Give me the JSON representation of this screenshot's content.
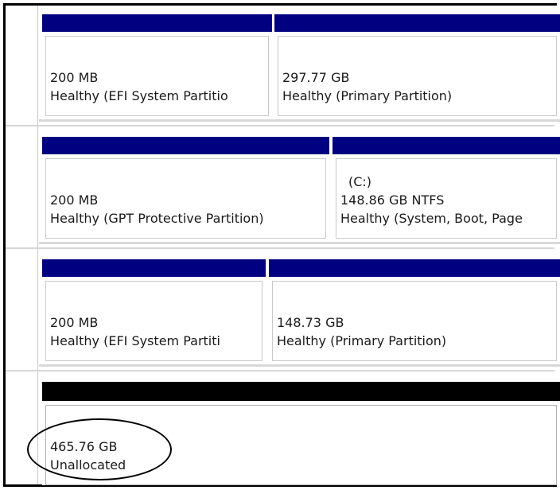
{
  "disks": [
    {
      "partitions": [
        {
          "size": "200 MB",
          "status": "Healthy (EFI System Partitio",
          "label": ""
        },
        {
          "size": "297.77 GB",
          "status": "Healthy (Primary Partition)",
          "label": ""
        }
      ]
    },
    {
      "partitions": [
        {
          "size": "200 MB",
          "status": "Healthy (GPT Protective Partition)",
          "label": ""
        },
        {
          "label": "(C:)",
          "size": "148.86 GB NTFS",
          "status": "Healthy (System, Boot, Page"
        }
      ]
    },
    {
      "partitions": [
        {
          "size": "200 MB",
          "status": "Healthy (EFI System Partiti",
          "label": ""
        },
        {
          "size": "148.73 GB",
          "status": "Healthy (Primary Partition)",
          "label": ""
        }
      ]
    },
    {
      "partitions": [
        {
          "size": "465.76 GB",
          "status": "Unallocated",
          "label": ""
        }
      ]
    }
  ],
  "colors": {
    "primary_partition_bar": "#000080",
    "unallocated_bar": "#000000",
    "highlight_circle": "#000000"
  }
}
